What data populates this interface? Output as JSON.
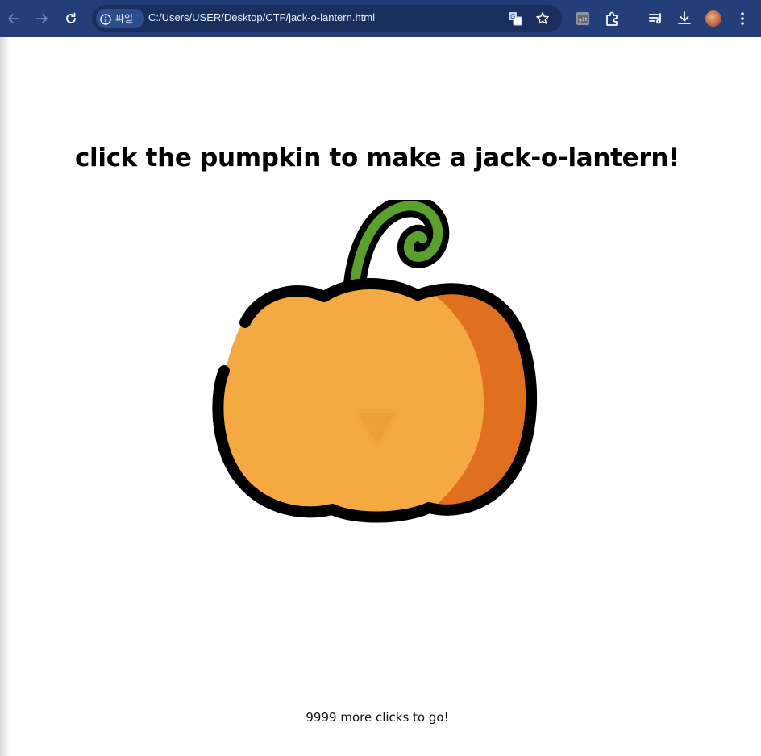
{
  "browser": {
    "site_info_label": "파일",
    "url": "C:/Users/USER/Desktop/CTF/jack-o-lantern.html"
  },
  "page": {
    "headline": "click the pumpkin to make a jack-o-lantern!",
    "counter_text": "9999 more clicks to go!"
  },
  "icons": {
    "back": "back-arrow-icon",
    "forward": "forward-arrow-icon",
    "reload": "reload-icon",
    "info": "info-icon",
    "translate": "translate-icon",
    "bookmark": "star-icon",
    "extension_badge": "extension-badge-icon",
    "extensions": "puzzle-icon",
    "reading_list": "reading-list-icon",
    "downloads": "download-icon",
    "profile": "avatar-icon",
    "menu": "kebab-menu-icon",
    "pumpkin": "pumpkin-icon"
  },
  "colors": {
    "toolbar": "#243e7a",
    "omnibox": "#1b2f5f",
    "pumpkin_body": "#f4a942",
    "pumpkin_shade": "#e07020",
    "stem": "#5aa02c",
    "outline": "#000000"
  }
}
